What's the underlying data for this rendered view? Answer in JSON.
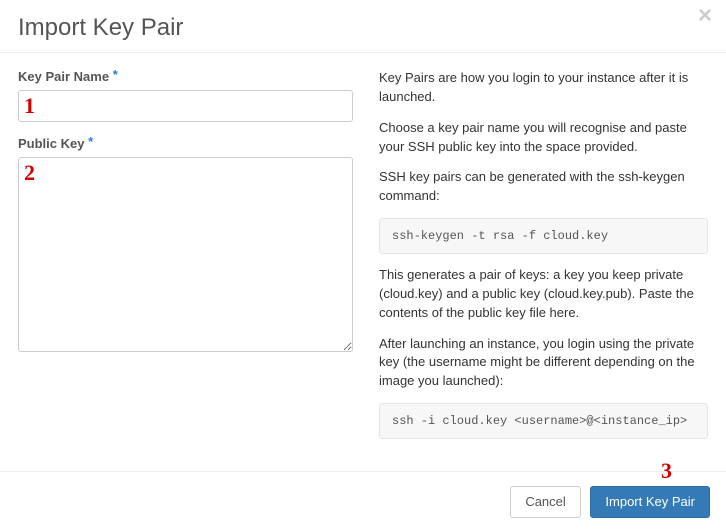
{
  "header": {
    "title": "Import Key Pair"
  },
  "form": {
    "keyPairName": {
      "label": "Key Pair Name",
      "value": ""
    },
    "publicKey": {
      "label": "Public Key",
      "value": ""
    }
  },
  "annotations": {
    "n1": "1",
    "n2": "2",
    "n3": "3"
  },
  "help": {
    "p1": "Key Pairs are how you login to your instance after it is launched.",
    "p2": "Choose a key pair name you will recognise and paste your SSH public key into the space provided.",
    "p3": "SSH key pairs can be generated with the ssh-keygen command:",
    "cmd1": "ssh-keygen -t rsa -f cloud.key",
    "p4": "This generates a pair of keys: a key you keep private (cloud.key) and a public key (cloud.key.pub). Paste the contents of the public key file here.",
    "p5": "After launching an instance, you login using the private key (the username might be different depending on the image you launched):",
    "cmd2": "ssh -i cloud.key <username>@<instance_ip>"
  },
  "footer": {
    "cancel": "Cancel",
    "submit": "Import Key Pair"
  }
}
